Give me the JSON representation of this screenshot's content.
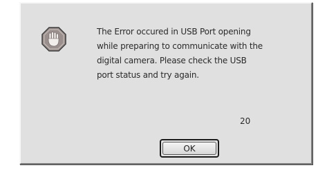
{
  "dialog": {
    "icon": "stop-hand-icon",
    "message_lines": [
      "The Error occured in USB Port opening",
      "while preparing to communicate with the",
      "digital camera. Please check the USB",
      "port status and try again."
    ],
    "error_code": "20",
    "ok_label": "OK"
  },
  "colors": {
    "dialog_bg": "#e0e0e0",
    "icon_fill": "#9a8f8c"
  }
}
